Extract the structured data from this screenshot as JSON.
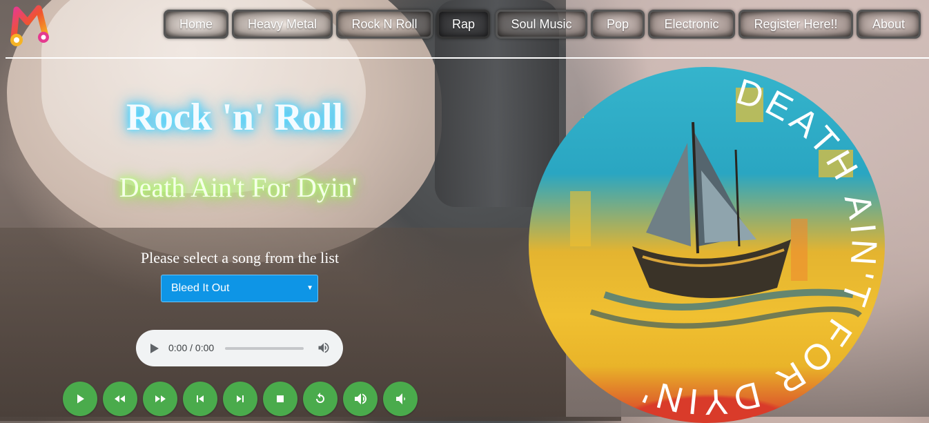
{
  "nav": {
    "items": [
      {
        "label": "Home"
      },
      {
        "label": "Heavy Metal"
      },
      {
        "label": "Rock N Roll"
      },
      {
        "label": "Rap"
      },
      {
        "label": "Soul Music"
      },
      {
        "label": "Pop"
      },
      {
        "label": "Electronic"
      },
      {
        "label": "Register Here!!"
      },
      {
        "label": "About"
      }
    ]
  },
  "page": {
    "title": "Rock 'n' Roll",
    "subtitle": "Death Ain't For Dyin'",
    "prompt": "Please select a song from the list"
  },
  "song_select": {
    "selected": "Bleed It Out"
  },
  "audio": {
    "time": "0:00 / 0:00"
  },
  "album_art": {
    "text": "DEATH AIN'T FOR DYIN'"
  },
  "controls": [
    {
      "icon": "play-icon"
    },
    {
      "icon": "rewind-icon"
    },
    {
      "icon": "fast-forward-icon"
    },
    {
      "icon": "skip-previous-icon"
    },
    {
      "icon": "skip-next-icon"
    },
    {
      "icon": "stop-icon"
    },
    {
      "icon": "replay-icon"
    },
    {
      "icon": "volume-up-icon"
    },
    {
      "icon": "volume-down-icon"
    }
  ],
  "colors": {
    "control_green": "#4aab4c",
    "select_blue": "#0e95e6",
    "title_glow": "#2ec9ff",
    "subtitle_glow": "#9cff4a"
  }
}
